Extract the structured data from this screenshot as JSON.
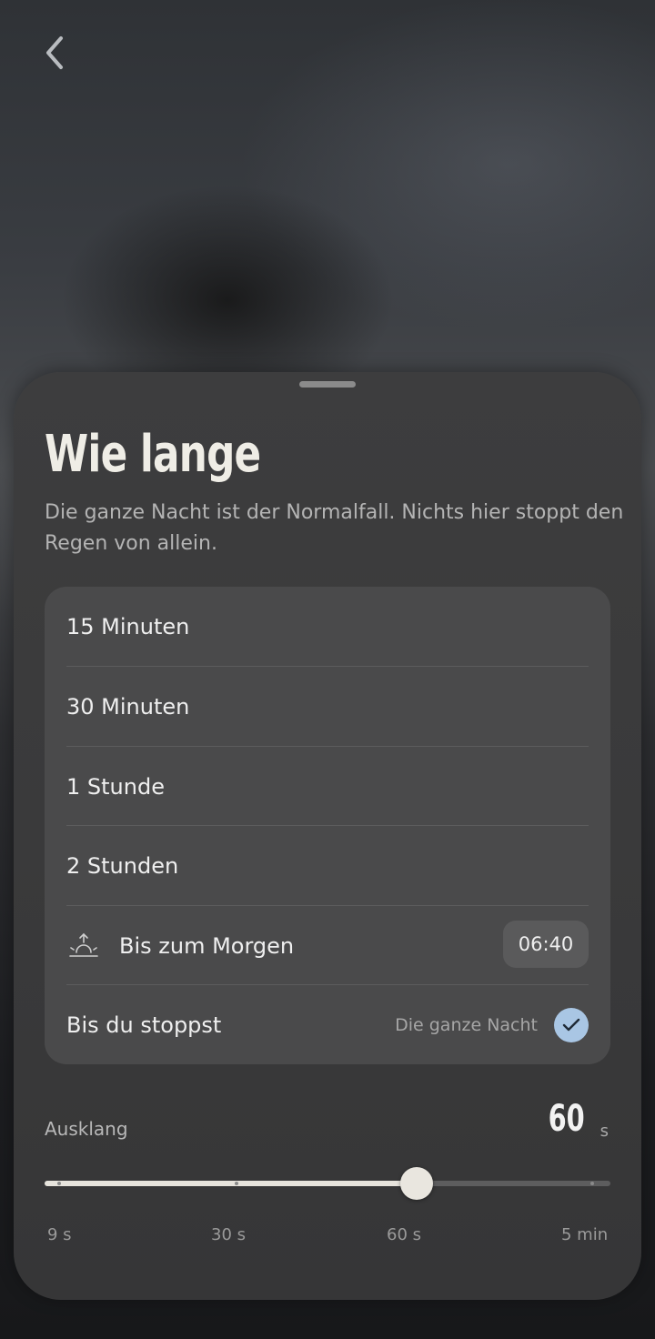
{
  "header": {
    "back_icon": "chevron-left-icon"
  },
  "sheet": {
    "title": "Wie lange",
    "subtitle": "Die ganze Nacht ist der Normalfall. Nichts hier stoppt den Regen von allein.",
    "options": [
      {
        "label": "15 Minuten"
      },
      {
        "label": "30 Minuten"
      },
      {
        "label": "1 Stunde"
      },
      {
        "label": "2 Stunden"
      },
      {
        "label": "Bis zum Morgen",
        "icon": "sunrise-icon",
        "time": "06:40"
      },
      {
        "label": "Bis du stoppst",
        "hint": "Die ganze Nacht",
        "selected": true,
        "icon": "check-icon"
      }
    ]
  },
  "fade": {
    "label": "Ausklang",
    "value": "60",
    "unit": "s",
    "slider": {
      "stops": [
        "9 s",
        "30 s",
        "60 s",
        "5 min"
      ],
      "selected_stop": "60 s",
      "position_fraction": 0.658
    }
  },
  "colors": {
    "sheet": "#3b3b3c",
    "card": "#4a4a4b",
    "accent_check": "#a9c6e4",
    "slider_fill": "#e6e3dc"
  }
}
